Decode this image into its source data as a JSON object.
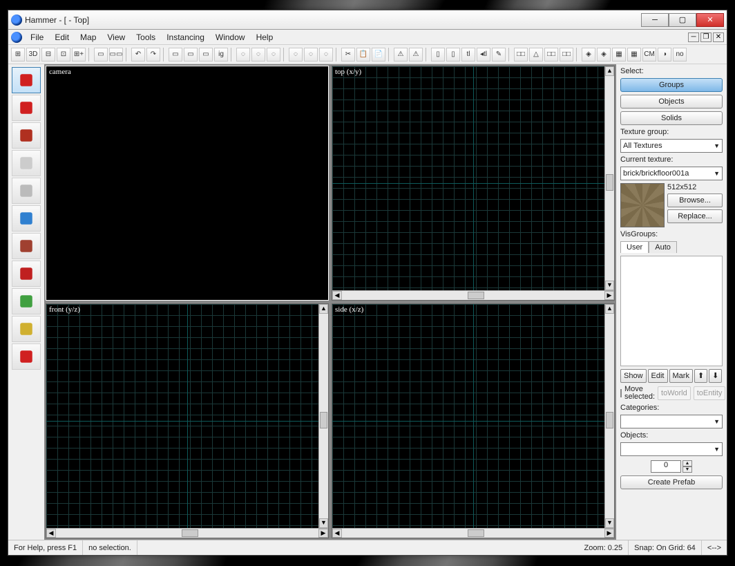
{
  "window": {
    "title": "Hammer - [ - Top]"
  },
  "menu": {
    "items": [
      "File",
      "Edit",
      "Map",
      "View",
      "Tools",
      "Instancing",
      "Window",
      "Help"
    ]
  },
  "toolbar_icons": [
    "⊞",
    "3D",
    "⊟",
    "⊡",
    "⊞+",
    "|",
    "▭",
    "▭▭",
    "|",
    "↶",
    "↷",
    "|",
    "▭",
    "▭",
    "▭",
    "ig",
    "|",
    "◌",
    "◌",
    "◌",
    "|",
    "◌",
    "◌",
    "◌",
    "|",
    "✂",
    "📋",
    "📄",
    "|",
    "⚠",
    "⚠",
    "|",
    "▯",
    "▯",
    "tl",
    "◂tl",
    "✎",
    "|",
    "□□",
    "△",
    "□□",
    "□□",
    "|",
    "◈",
    "◈",
    "▦",
    "▦",
    "CM",
    "◑",
    "no"
  ],
  "tools": [
    {
      "name": "selection-tool",
      "color": "#d02020"
    },
    {
      "name": "magnify-tool",
      "color": "#d02020"
    },
    {
      "name": "camera-tool",
      "color": "#b03020"
    },
    {
      "name": "entity-tool",
      "color": "#cccccc"
    },
    {
      "name": "block-tool",
      "color": "#bbbbbb"
    },
    {
      "name": "texture-tool",
      "color": "#3080d0"
    },
    {
      "name": "apply-texture-tool",
      "color": "#a04030"
    },
    {
      "name": "decal-tool",
      "color": "#c02020"
    },
    {
      "name": "overlay-tool",
      "color": "#40a040"
    },
    {
      "name": "clipping-tool",
      "color": "#d0b030"
    },
    {
      "name": "vertex-tool",
      "color": "#d02020"
    }
  ],
  "viewports": {
    "tl": {
      "label": "camera",
      "grid": false
    },
    "tr": {
      "label": "top (x/y)",
      "grid": true
    },
    "bl": {
      "label": "front (y/z)",
      "grid": true
    },
    "br": {
      "label": "side (x/z)",
      "grid": true
    }
  },
  "side": {
    "select_label": "Select:",
    "select_buttons": [
      "Groups",
      "Objects",
      "Solids"
    ],
    "texture_group_label": "Texture group:",
    "texture_group_value": "All Textures",
    "current_texture_label": "Current texture:",
    "current_texture_value": "brick/brickfloor001a",
    "texture_size": "512x512",
    "browse": "Browse...",
    "replace": "Replace...",
    "visgroups_label": "VisGroups:",
    "tabs": [
      "User",
      "Auto"
    ],
    "btnrow": [
      "Show",
      "Edit",
      "Mark",
      "⬆",
      "⬇"
    ],
    "move_label": "Move selected:",
    "move_buttons": [
      "toWorld",
      "toEntity"
    ],
    "categories_label": "Categories:",
    "objects_label": "Objects:",
    "number_value": "0",
    "create_prefab": "Create Prefab"
  },
  "status": {
    "help": "For Help, press F1",
    "selection": "no selection.",
    "zoom": "Zoom: 0.25",
    "snap": "Snap: On Grid: 64",
    "arrows": "<-->"
  }
}
